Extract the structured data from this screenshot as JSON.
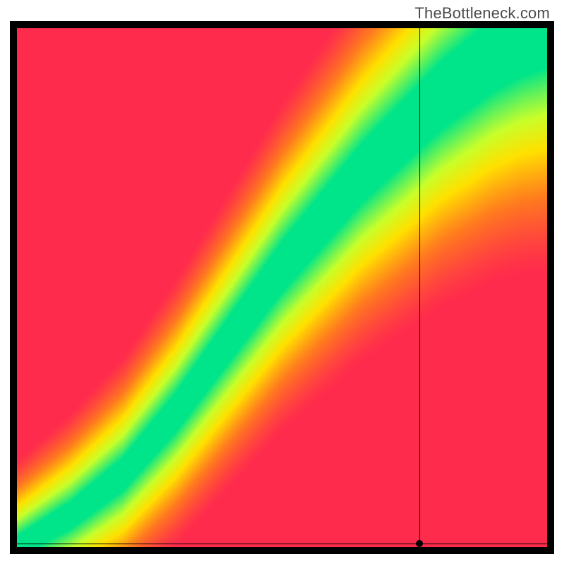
{
  "watermark": "TheBottleneck.com",
  "chart_data": {
    "type": "heatmap",
    "title": "",
    "xlabel": "",
    "ylabel": "",
    "xlim": [
      0,
      1
    ],
    "ylim": [
      0,
      1
    ],
    "colormap_stops": [
      {
        "t": 0.0,
        "color": "#ff2b4d"
      },
      {
        "t": 0.25,
        "color": "#ff7a1f"
      },
      {
        "t": 0.5,
        "color": "#ffe100"
      },
      {
        "t": 0.7,
        "color": "#c8ff2a"
      },
      {
        "t": 1.0,
        "color": "#00e58a"
      }
    ],
    "optimal_curve": [
      {
        "x": 0.0,
        "y": 0.0
      },
      {
        "x": 0.05,
        "y": 0.03
      },
      {
        "x": 0.1,
        "y": 0.06
      },
      {
        "x": 0.15,
        "y": 0.1
      },
      {
        "x": 0.2,
        "y": 0.14
      },
      {
        "x": 0.25,
        "y": 0.2
      },
      {
        "x": 0.3,
        "y": 0.26
      },
      {
        "x": 0.35,
        "y": 0.33
      },
      {
        "x": 0.4,
        "y": 0.4
      },
      {
        "x": 0.45,
        "y": 0.47
      },
      {
        "x": 0.5,
        "y": 0.54
      },
      {
        "x": 0.55,
        "y": 0.6
      },
      {
        "x": 0.6,
        "y": 0.66
      },
      {
        "x": 0.65,
        "y": 0.72
      },
      {
        "x": 0.7,
        "y": 0.77
      },
      {
        "x": 0.75,
        "y": 0.82
      },
      {
        "x": 0.8,
        "y": 0.87
      },
      {
        "x": 0.85,
        "y": 0.91
      },
      {
        "x": 0.9,
        "y": 0.95
      },
      {
        "x": 0.95,
        "y": 0.98
      },
      {
        "x": 1.0,
        "y": 1.0
      }
    ],
    "band_halfwidth_base": 0.02,
    "band_halfwidth_growth": 0.055,
    "falloff": 0.15,
    "marker": {
      "x": 0.76,
      "y": 0.005
    },
    "crosshair": {
      "x": 0.76,
      "y": 0.005
    }
  }
}
